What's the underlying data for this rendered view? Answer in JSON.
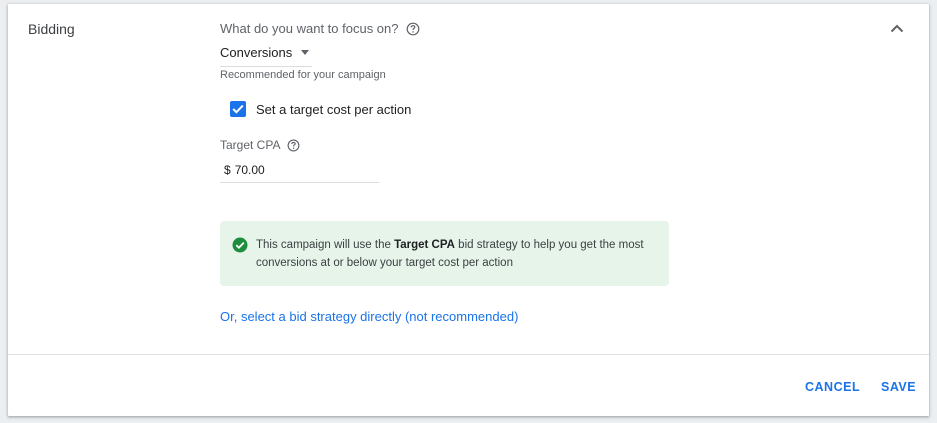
{
  "section": {
    "title": "Bidding"
  },
  "focus": {
    "question": "What do you want to focus on?",
    "selected": "Conversions",
    "hint": "Recommended for your campaign"
  },
  "target_checkbox": {
    "label": "Set a target cost per action",
    "checked": true
  },
  "target_cpa": {
    "label": "Target CPA",
    "currency": "$",
    "value": "70.00"
  },
  "info": {
    "text_before": "This campaign will use the ",
    "strategy": "Target CPA",
    "text_after": " bid strategy to help you get the most conversions at or below your target cost per action"
  },
  "link": {
    "label": "Or, select a bid strategy directly (not recommended)"
  },
  "actions": {
    "cancel": "CANCEL",
    "save": "SAVE"
  },
  "colors": {
    "accent": "#1a73e8",
    "success_bg": "#e6f4ea",
    "success_icon": "#1e8e3e"
  }
}
